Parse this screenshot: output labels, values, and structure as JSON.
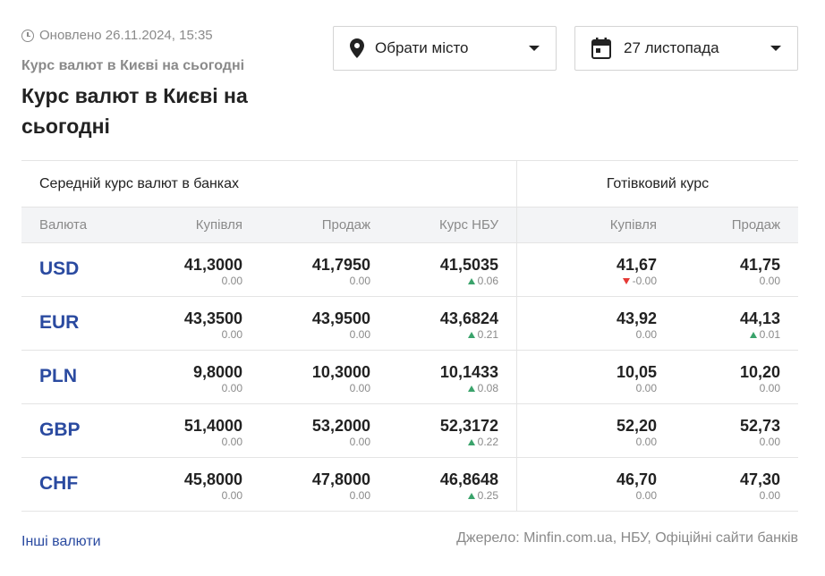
{
  "header": {
    "updated": "Оновлено 26.11.2024, 15:35",
    "subtitle": "Курс валют в Києві на сьогодні",
    "title": "Курс валют в Києві на сьогодні"
  },
  "filters": {
    "city_label": "Обрати місто",
    "date_label": "27 листопада"
  },
  "table": {
    "group_banks": "Середній курс валют в банках",
    "group_cash": "Готівковий курс",
    "columns": [
      "Валюта",
      "Купівля",
      "Продаж",
      "Курс НБУ",
      "Купівля",
      "Продаж"
    ],
    "rows": [
      {
        "code": "USD",
        "buy": "41,3000",
        "buy_d": "0.00",
        "sell": "41,7950",
        "sell_d": "0.00",
        "nbu": "41,5035",
        "nbu_d": "0.06",
        "nbu_dir": "up",
        "cash_buy": "41,67",
        "cash_buy_d": "-0.00",
        "cash_buy_dir": "down",
        "cash_sell": "41,75",
        "cash_sell_d": "0.00",
        "cash_sell_dir": ""
      },
      {
        "code": "EUR",
        "buy": "43,3500",
        "buy_d": "0.00",
        "sell": "43,9500",
        "sell_d": "0.00",
        "nbu": "43,6824",
        "nbu_d": "0.21",
        "nbu_dir": "up",
        "cash_buy": "43,92",
        "cash_buy_d": "0.00",
        "cash_buy_dir": "",
        "cash_sell": "44,13",
        "cash_sell_d": "0.01",
        "cash_sell_dir": "up"
      },
      {
        "code": "PLN",
        "buy": "9,8000",
        "buy_d": "0.00",
        "sell": "10,3000",
        "sell_d": "0.00",
        "nbu": "10,1433",
        "nbu_d": "0.08",
        "nbu_dir": "up",
        "cash_buy": "10,05",
        "cash_buy_d": "0.00",
        "cash_buy_dir": "",
        "cash_sell": "10,20",
        "cash_sell_d": "0.00",
        "cash_sell_dir": ""
      },
      {
        "code": "GBP",
        "buy": "51,4000",
        "buy_d": "0.00",
        "sell": "53,2000",
        "sell_d": "0.00",
        "nbu": "52,3172",
        "nbu_d": "0.22",
        "nbu_dir": "up",
        "cash_buy": "52,20",
        "cash_buy_d": "0.00",
        "cash_buy_dir": "",
        "cash_sell": "52,73",
        "cash_sell_d": "0.00",
        "cash_sell_dir": ""
      },
      {
        "code": "CHF",
        "buy": "45,8000",
        "buy_d": "0.00",
        "sell": "47,8000",
        "sell_d": "0.00",
        "nbu": "46,8648",
        "nbu_d": "0.25",
        "nbu_dir": "up",
        "cash_buy": "46,70",
        "cash_buy_d": "0.00",
        "cash_buy_dir": "",
        "cash_sell": "47,30",
        "cash_sell_d": "0.00",
        "cash_sell_dir": ""
      }
    ]
  },
  "footer": {
    "other_link": "Інші валюти",
    "source": "Джерело: Minfin.com.ua, НБУ, Офіційні сайти банків"
  },
  "colors": {
    "accent": "#2a4aa0",
    "up": "#3aa36b",
    "down": "#e53935",
    "muted": "#8a8a8a"
  }
}
